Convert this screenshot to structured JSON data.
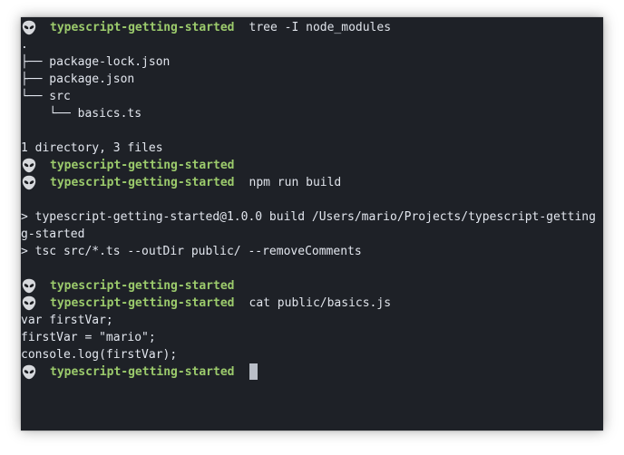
{
  "terminal": {
    "prompt_icon": "alien-emoji-icon",
    "prompt_dir": "typescript-getting-started",
    "colors": {
      "background": "#1e2127",
      "prompt": "#9ccb6c",
      "text": "#e2e6ee"
    },
    "lines": [
      {
        "type": "prompt",
        "cmd": "tree -I node_modules"
      },
      {
        "type": "out",
        "text": "."
      },
      {
        "type": "out",
        "text": "├── package-lock.json"
      },
      {
        "type": "out",
        "text": "├── package.json"
      },
      {
        "type": "out",
        "text": "└── src"
      },
      {
        "type": "out",
        "text": "    └── basics.ts"
      },
      {
        "type": "out",
        "text": ""
      },
      {
        "type": "out",
        "text": "1 directory, 3 files"
      },
      {
        "type": "prompt",
        "cmd": ""
      },
      {
        "type": "prompt",
        "cmd": "npm run build"
      },
      {
        "type": "out",
        "text": ""
      },
      {
        "type": "out",
        "text": "> typescript-getting-started@1.0.0 build /Users/mario/Projects/typescript-getting"
      },
      {
        "type": "out",
        "text": "g-started"
      },
      {
        "type": "out",
        "text": "> tsc src/*.ts --outDir public/ --removeComments"
      },
      {
        "type": "out",
        "text": ""
      },
      {
        "type": "prompt",
        "cmd": ""
      },
      {
        "type": "prompt",
        "cmd": "cat public/basics.js"
      },
      {
        "type": "out",
        "text": "var firstVar;"
      },
      {
        "type": "out",
        "text": "firstVar = \"mario\";"
      },
      {
        "type": "out",
        "text": "console.log(firstVar);"
      },
      {
        "type": "prompt",
        "cmd": "",
        "cursor": true
      }
    ]
  }
}
